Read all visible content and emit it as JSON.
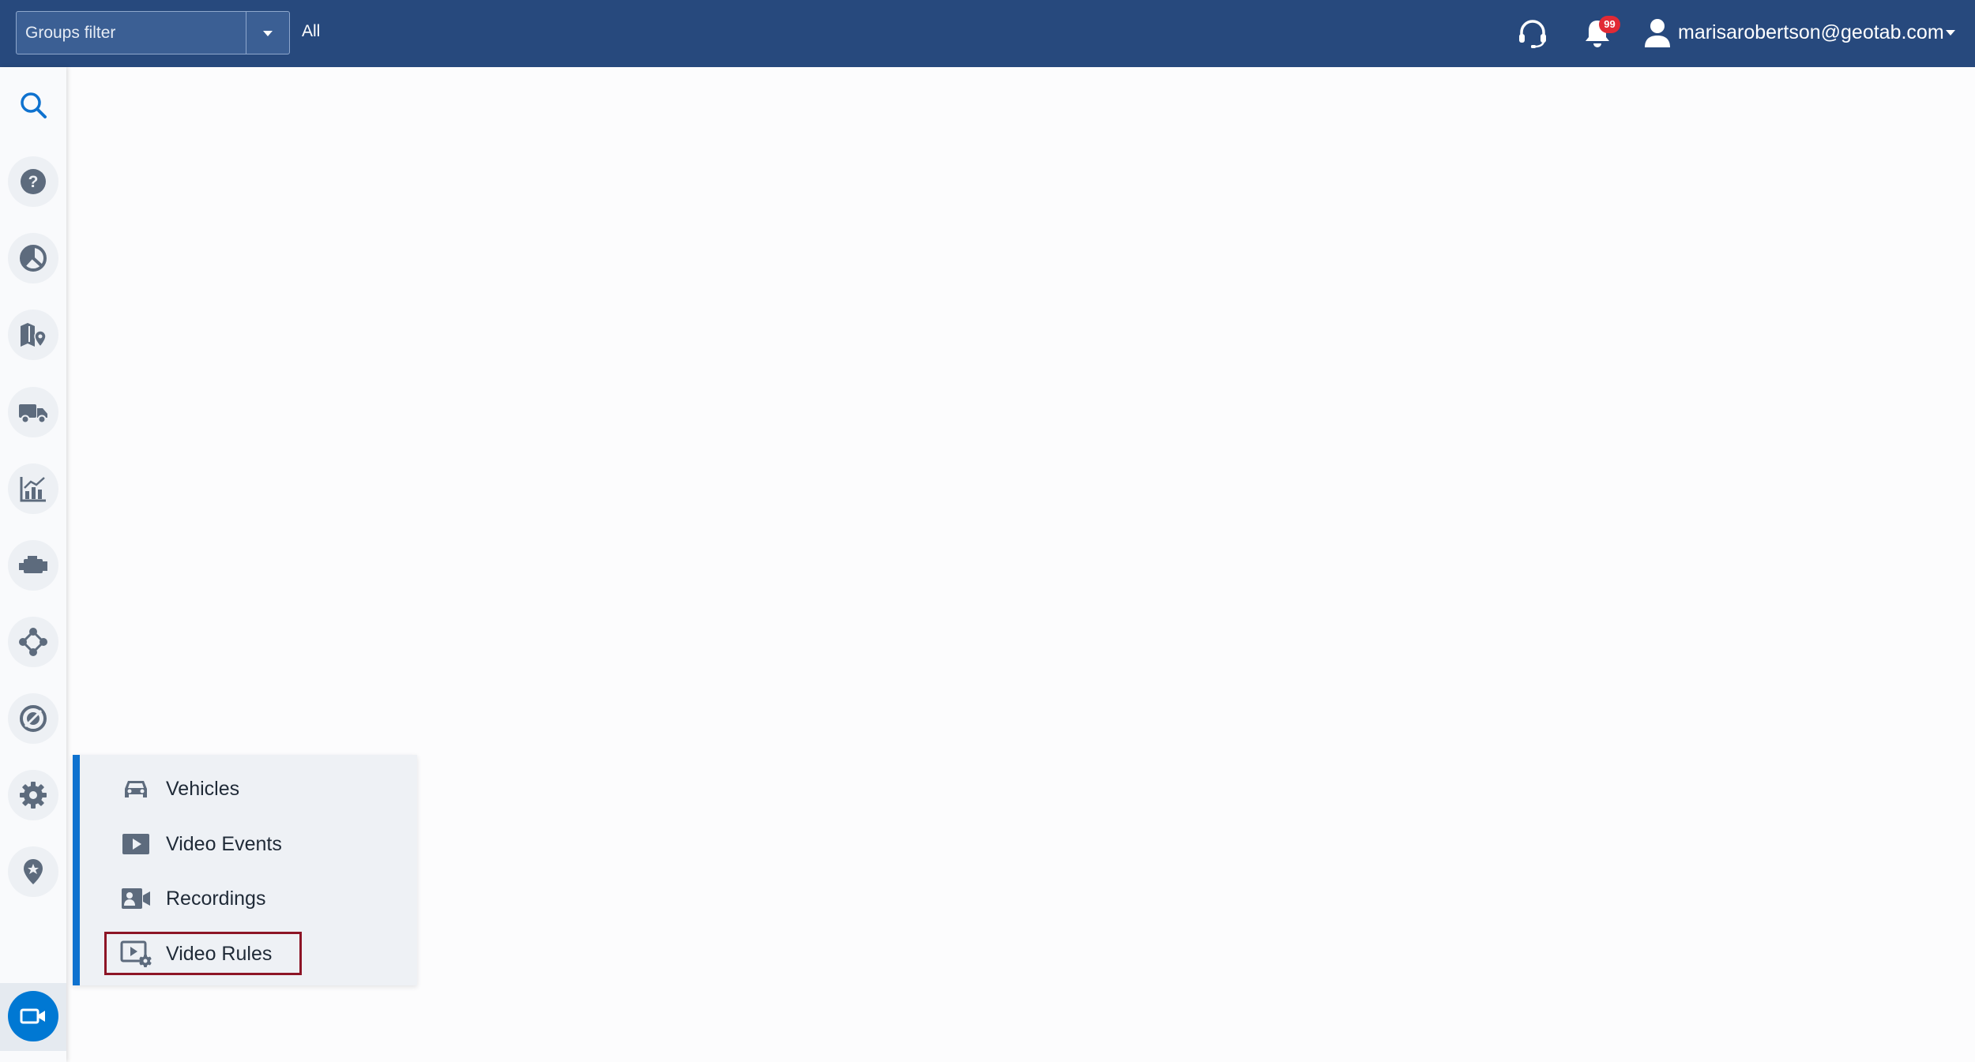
{
  "header": {
    "groups_filter": {
      "placeholder": "Groups filter",
      "value": ""
    },
    "filter_value": "All",
    "notifications_badge": "99",
    "user_email": "marisarobertson@geotab.com",
    "background_color": "#27497d"
  },
  "rail": {
    "items": [
      {
        "icon": "search-icon"
      },
      {
        "icon": "help-icon"
      },
      {
        "icon": "dashboard-pie-icon"
      },
      {
        "icon": "map-icon"
      },
      {
        "icon": "truck-icon"
      },
      {
        "icon": "chart-icon"
      },
      {
        "icon": "engine-icon"
      },
      {
        "icon": "network-icon"
      },
      {
        "icon": "rules-icon"
      },
      {
        "icon": "gear-icon"
      },
      {
        "icon": "location-pin-icon"
      },
      {
        "icon": "video-camera-icon",
        "active": true
      }
    ],
    "accent_color": "#0078d3"
  },
  "flyout": {
    "items": [
      {
        "label": "Vehicles",
        "icon": "car-icon"
      },
      {
        "label": "Video Events",
        "icon": "play-icon"
      },
      {
        "label": "Recordings",
        "icon": "recordings-icon"
      },
      {
        "label": "Video Rules",
        "icon": "video-settings-icon",
        "highlighted": true
      }
    ],
    "highlight_color": "#8d1526"
  }
}
